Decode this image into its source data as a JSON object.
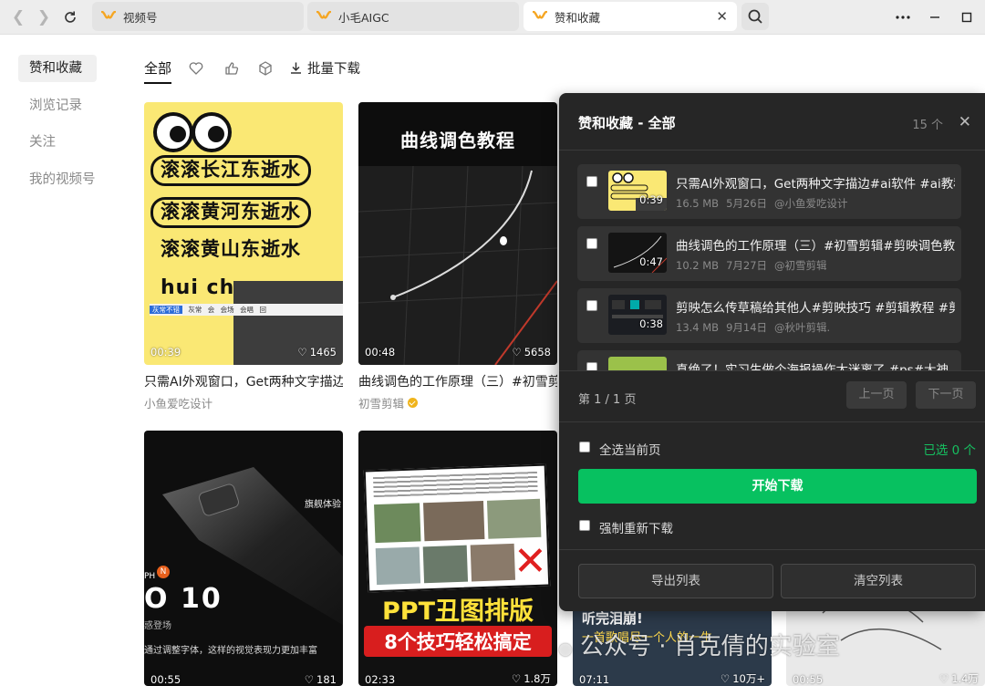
{
  "tabs": [
    {
      "label": "视频号"
    },
    {
      "label": "小毛AIGC"
    },
    {
      "label": "赞和收藏"
    }
  ],
  "sidebar": {
    "items": [
      {
        "label": "赞和收藏"
      },
      {
        "label": "浏览记录"
      },
      {
        "label": "关注"
      },
      {
        "label": "我的视频号"
      }
    ]
  },
  "filters": {
    "all_label": "全部",
    "batch_download": "批量下载"
  },
  "cards": [
    {
      "duration": "00:39",
      "likes": "1465",
      "title": "只需AI外观窗口，Get两种文字描边#ai软件 #ai教程",
      "author": "小鱼爱吃设计",
      "poster_lines": [
        "滚滚长江东逝水",
        "滚滚黄河东逝水",
        "滚滚黄山东逝水",
        "hui cha"
      ],
      "ui_chips": [
        "灰常不错",
        "灰常",
        "会",
        "会场",
        "会唱",
        "回"
      ]
    },
    {
      "duration": "00:48",
      "likes": "5658",
      "title": "曲线调色的工作原理（三）#初雪剪辑",
      "author": "初雪剪辑",
      "poster_title": "曲线调色教程"
    },
    {
      "duration": "00:55",
      "likes": "181",
      "title": "",
      "author": "",
      "overlay_big": "O 10",
      "side_text": "旗舰体验",
      "caption": "通过调整字体，这样的视觉表现力更加丰富",
      "sub_caption": "惑登场",
      "ph_text": "PH"
    },
    {
      "duration": "02:33",
      "likes": "1.8万",
      "title": "",
      "author": "",
      "headline1": "PPT丑图排版",
      "headline2": "8个技巧轻松搞定"
    },
    {
      "duration": "07:11",
      "likes": "10万+",
      "overlay_text1": "听完泪崩!",
      "overlay_text2": "一首歌唱尽一个人的一生"
    },
    {
      "duration": "00:55",
      "likes": "1.4万"
    }
  ],
  "panel": {
    "title": "赞和收藏 - 全部",
    "count": "15 个",
    "items": [
      {
        "title": "只需AI外观窗口，Get两种文字描边#ai软件 #ai教程",
        "size": "16.5 MB",
        "date": "5月26日",
        "author": "@小鱼爱吃设计",
        "duration": "0:39"
      },
      {
        "title": "曲线调色的工作原理（三）#初雪剪辑#剪映调色教程",
        "size": "10.2 MB",
        "date": "7月27日",
        "author": "@初雪剪辑",
        "duration": "0:47"
      },
      {
        "title": "剪映怎么传草稿给其他人#剪映技巧 #剪辑教程 #剪映",
        "size": "13.4 MB",
        "date": "9月14日",
        "author": "@秋叶剪辑.",
        "duration": "0:38"
      },
      {
        "title": "真绝了！实习生做个海报操作太迷离了 #ps#大神",
        "size": "",
        "date": "",
        "author": "",
        "duration": ""
      }
    ],
    "page_info": "第 1 / 1 页",
    "prev": "上一页",
    "next": "下一页",
    "select_all": "全选当前页",
    "selected": "已选 0 个",
    "start_download": "开始下载",
    "force_redownload": "强制重新下载",
    "export_list": "导出列表",
    "clear_list": "清空列表"
  },
  "watermark": "公众号 · 肖克倩的实验室",
  "colors": {
    "accent_green": "#07c160",
    "panel_bg": "#262626",
    "tab_logo": "#f5a623"
  }
}
